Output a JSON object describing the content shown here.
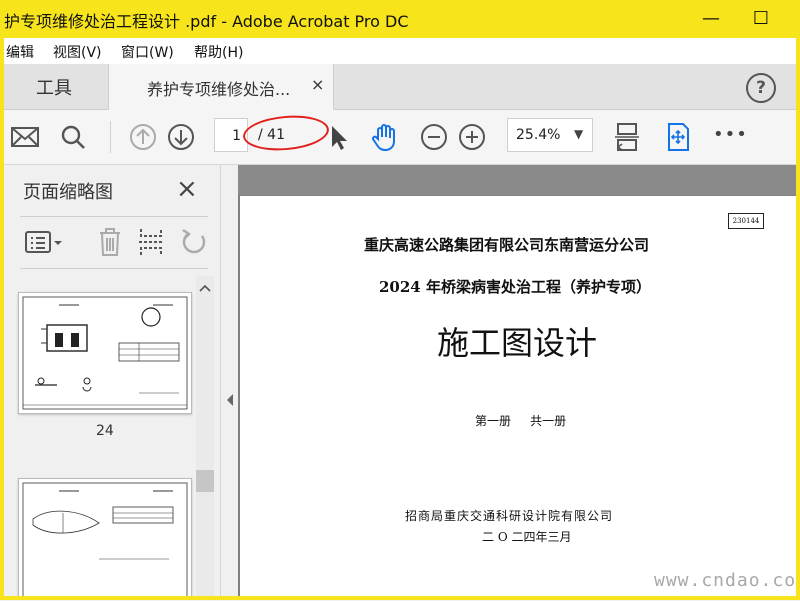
{
  "window": {
    "title": "护专项维修处治工程设计 .pdf - Adobe Acrobat Pro DC",
    "minimize": "—",
    "maximize": "☐"
  },
  "menu": [
    "编辑",
    "视图(V)",
    "窗口(W)",
    "帮助(H)"
  ],
  "tabs": {
    "tools": "工具",
    "document": "养护专项维修处治...",
    "close": "×",
    "help": "?"
  },
  "toolbar": {
    "current_page": "1",
    "page_total": "/ 41",
    "zoom": "25.4%",
    "zoom_caret": "▼",
    "more": "•••"
  },
  "sidebar": {
    "title": "页面缩略图",
    "close": "×",
    "thumb_label": "24"
  },
  "document": {
    "code": "230144",
    "company": "重庆高速公路集团有限公司东南营运分公司",
    "project": "2024 年桥梁病害处治工程（养护专项）",
    "heading": "施工图设计",
    "volume": "第一册     共一册",
    "designer": "招商局重庆交通科研设计院有限公司",
    "date": "二 O 二四年三月"
  },
  "watermark": "www.cndao.com",
  "colors": {
    "titlebar": "#f7e41a",
    "accent_blue": "#1473e6",
    "annotation_red": "#e0201b"
  }
}
